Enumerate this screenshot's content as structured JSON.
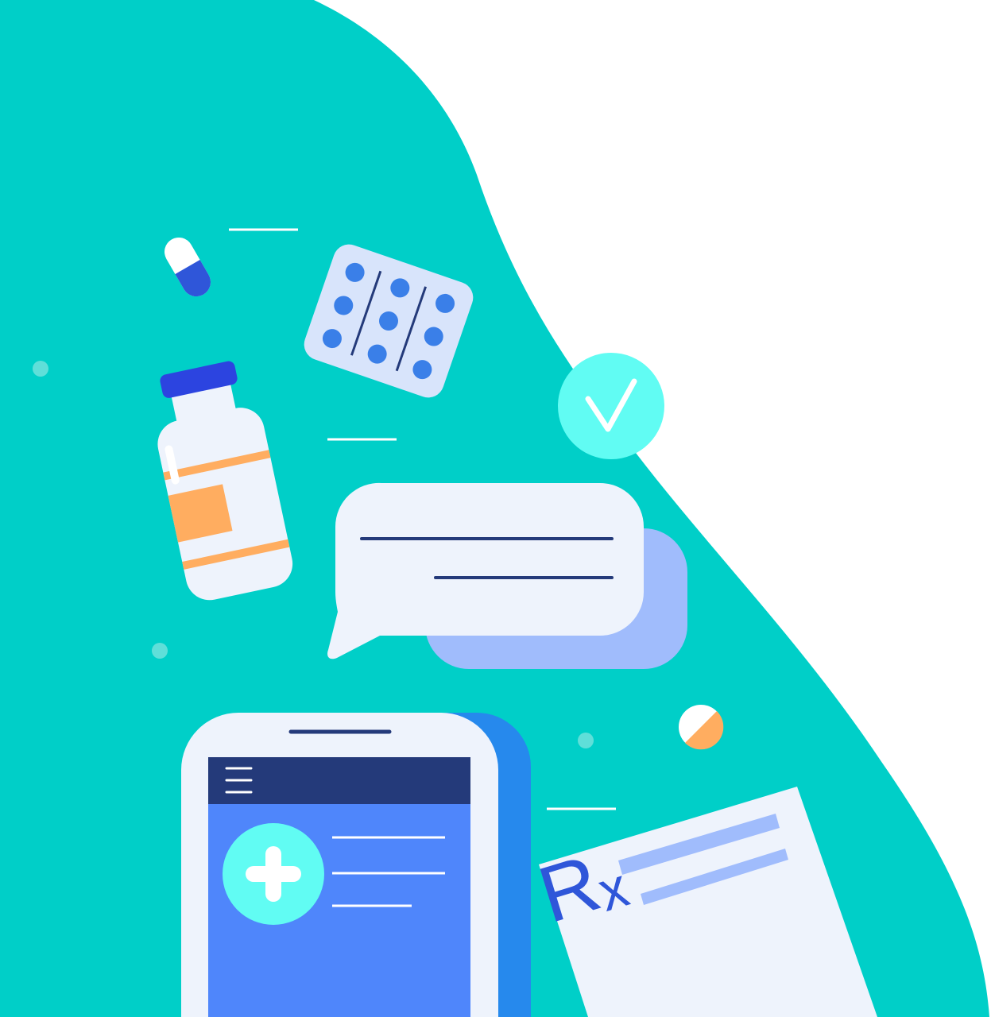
{
  "colors": {
    "background": "#ffffff",
    "teal_blob": "#00cfc8",
    "light_panel": "#eef3fc",
    "navy": "#243a7a",
    "phone_screen": "#4f86fb",
    "phone_side": "#2689ed",
    "cyan_accent": "#61fcf3",
    "pill_blue": "#2f56d9",
    "blister_dot": "#3a7fe8",
    "bottle_cap": "#2c44e0",
    "label_orange": "#ffad60",
    "bubble_back": "#a0bcfc",
    "rx_lines": "#a0bcfc",
    "rx_letters": "#2f56d9",
    "sparkle": "#5fdfd9"
  },
  "illustration": {
    "icons": [
      "capsule-icon",
      "blister-pack-icon",
      "medicine-bottle-icon",
      "checkmark-badge-icon",
      "chat-bubble-icon",
      "smartphone-icon",
      "menu-icon",
      "medical-cross-icon",
      "tablet-pill-icon",
      "prescription-paper-icon"
    ],
    "prescription_symbol": "Rₓ"
  }
}
